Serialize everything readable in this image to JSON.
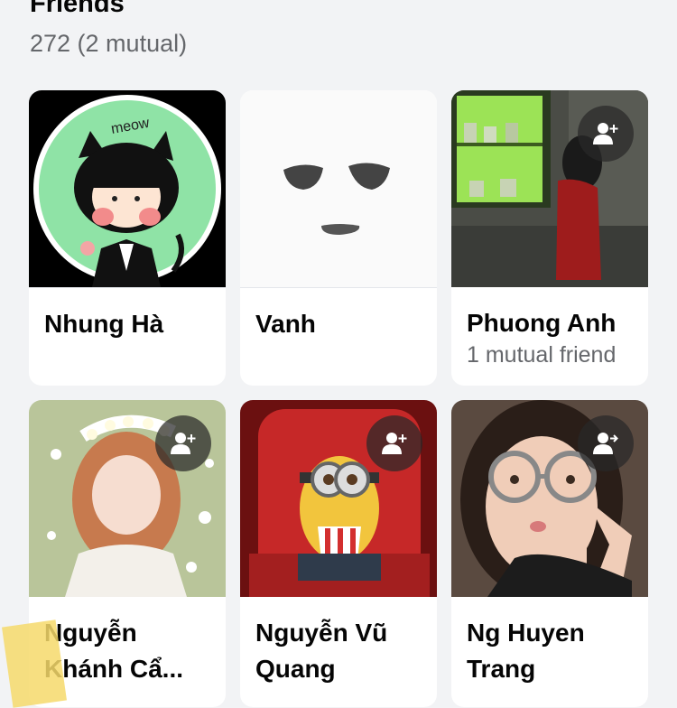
{
  "header": {
    "title": "Friends",
    "count_text": "272 (2 mutual)"
  },
  "friends": [
    {
      "name": "Nhung Hà",
      "sub": "",
      "avatar": "cat-character-avatar",
      "has_add_button": false
    },
    {
      "name": "Vanh",
      "sub": "",
      "avatar": "face-sketch-avatar",
      "has_add_button": false
    },
    {
      "name": "Phuong Anh",
      "sub": "1 mutual friend",
      "avatar": "girl-neon-room-photo",
      "has_add_button": true
    },
    {
      "name": "Nguyễn Khánh Cẩ...",
      "sub": "",
      "avatar": "flower-crown-photo",
      "has_add_button": true
    },
    {
      "name": "Nguyễn Vũ Quang",
      "sub": "",
      "avatar": "minion-popcorn-photo",
      "has_add_button": true
    },
    {
      "name": "Ng Huyen Trang",
      "sub": "",
      "avatar": "glasses-selfie-photo",
      "has_add_button": true
    }
  ],
  "icons": {
    "add_friend": "add-friend-icon"
  },
  "colors": {
    "card_bg": "#ffffff",
    "page_bg": "#f2f3f5",
    "secondary_text": "#65676b"
  }
}
